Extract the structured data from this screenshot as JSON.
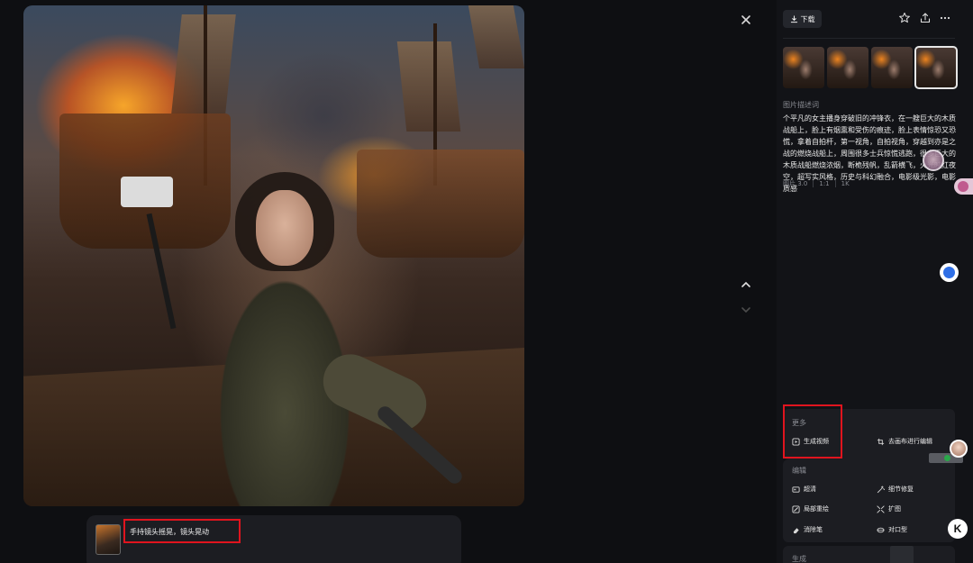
{
  "viewer": {
    "close_icon": "close-icon",
    "nav_up_icon": "chevron-up-icon",
    "nav_down_icon": "chevron-down-icon"
  },
  "prompt": {
    "text": "手持镜头摇晃，镜头晃动"
  },
  "panel": {
    "download_label": "下载",
    "icons": [
      "star-icon",
      "share-icon",
      "more-icon"
    ],
    "description_label": "图片描述词",
    "description": "个平凡的女主播身穿破旧的冲锋衣，在一艘巨大的木质战船上，脸上有烟熏和受伤的痕迹，脸上表情惊恐又恐慌，拿着自拍杆，第一视角，自拍视角，穿越到亦是之战的燃烧战船上，周围很多士兵惊慌逃跑，很多巨大的木质战船燃烧浓烟，断桅残帆，乱箭横飞，火光映红夜空，超写实风格，历史与科幻融合，电影级光影，电影质感",
    "meta": [
      "图片 3.0",
      "1:1",
      "1K"
    ]
  },
  "more": {
    "title": "更多",
    "generate_video": "生成视频",
    "canvas_edit": "去画布进行编辑"
  },
  "edit": {
    "title": "编辑",
    "items": [
      "超清",
      "细节修复",
      "局部重绘",
      "扩图",
      "消除笔",
      "对口型"
    ]
  },
  "generate": {
    "title": "生成"
  },
  "colors": {
    "highlight": "#e0141e",
    "panel_bg": "#121317",
    "card_bg": "#1c1d22"
  }
}
